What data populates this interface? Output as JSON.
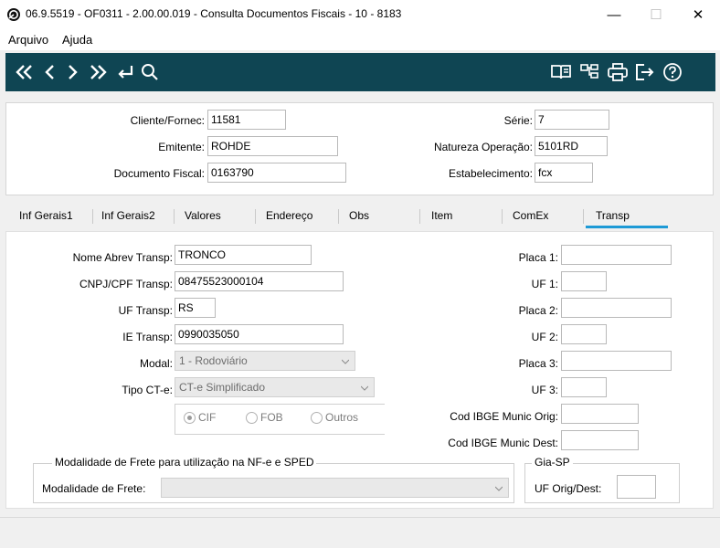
{
  "window": {
    "title": "06.9.5519 - OF0311 - 2.00.00.019 - Consulta Documentos Fiscais - 10 - 8183",
    "minimize": "—",
    "maximize": "☐",
    "close": "✕"
  },
  "menu": {
    "items": [
      "Arquivo",
      "Ajuda"
    ]
  },
  "toolbar": {
    "accent": "#0f4553",
    "nav_icons": [
      "first-record-icon",
      "previous-record-icon",
      "next-record-icon",
      "last-record-icon",
      "return-icon",
      "search-icon"
    ],
    "right_icons": [
      "manual-book-icon",
      "structure-icon",
      "print-icon",
      "exit-icon",
      "help-icon"
    ]
  },
  "header": {
    "cliente_label": "Cliente/Fornec:",
    "cliente_value": "11581",
    "emitente_label": "Emitente:",
    "emitente_value": "ROHDE",
    "documento_label": "Documento Fiscal:",
    "documento_value": "0163790",
    "serie_label": "Série:",
    "serie_value": "7",
    "natureza_label": "Natureza Operação:",
    "natureza_value": "5101RD",
    "estab_label": "Estabelecimento:",
    "estab_value": "fcx"
  },
  "tabs": {
    "items": [
      "Inf Gerais1",
      "Inf Gerais2",
      "Valores",
      "Endereço",
      "Obs",
      "Item",
      "ComEx",
      "Transp"
    ],
    "active": "Transp",
    "active_color": "#1e9ad6"
  },
  "transp": {
    "nome_label": "Nome Abrev Transp:",
    "nome_value": "TRONCO",
    "cnpj_label": "CNPJ/CPF Transp:",
    "cnpj_value": "08475523000104",
    "uf_label": "UF Transp:",
    "uf_value": "RS",
    "ie_label": "IE Transp:",
    "ie_value": "0990035050",
    "modal_label": "Modal:",
    "modal_value": "1 - Rodoviário",
    "tipo_label": "Tipo CT-e:",
    "tipo_value": "CT-e Simplificado",
    "freight_options": [
      "CIF",
      "FOB",
      "Outros"
    ],
    "freight_selected": "CIF",
    "placa1_label": "Placa 1:",
    "uf1_label": "UF 1:",
    "placa2_label": "Placa 2:",
    "uf2_label": "UF 2:",
    "placa3_label": "Placa 3:",
    "uf3_label": "UF 3:",
    "ibge_orig_label": "Cod IBGE Munic Orig:",
    "ibge_dest_label": "Cod IBGE Munic Dest:",
    "modalidade_group": "Modalidade de Frete para utilização na NF-e e SPED",
    "modalidade_label": "Modalidade de Frete:",
    "modalidade_value": "",
    "gia_group": "Gia-SP",
    "uf_orig_dest_label": "UF Orig/Dest:"
  }
}
